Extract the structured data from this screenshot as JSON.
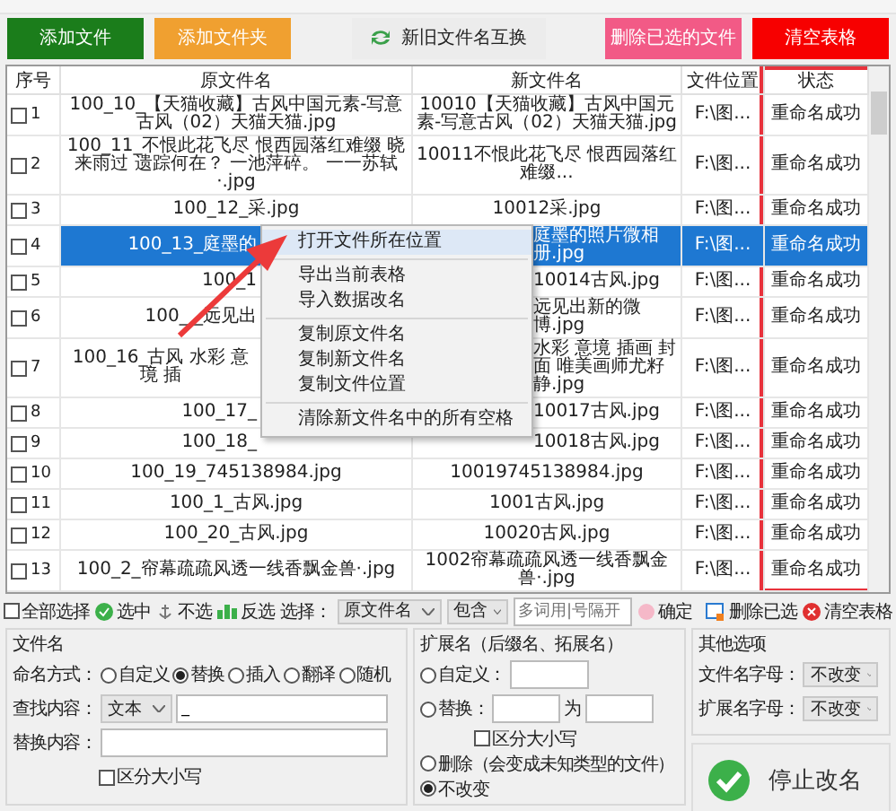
{
  "top_buttons": [
    {
      "label": "添加文件",
      "color": "#1b7d1b"
    },
    {
      "label": "添加文件夹",
      "color": "#f0a030"
    },
    {
      "label": "删除已选的文件",
      "color": "#f25a86"
    },
    {
      "label": "清空表格",
      "color": "#f70000"
    }
  ],
  "swap_button": {
    "label": "新旧文件名互换"
  },
  "table": {
    "columns": [
      "序号",
      "原文件名",
      "新文件名",
      "文件位置",
      "状态"
    ],
    "rows": [
      {
        "index": "1",
        "checked": false,
        "selected": false,
        "covered": false,
        "original": "100_10_【天猫收藏】古风中国元素-写意古风（02）天猫天猫.jpg",
        "new": "10010【天猫收藏】古风中国元素-写意古风（02）天猫天猫.jpg",
        "location": "F:\\图...",
        "status": "重命名成功"
      },
      {
        "index": "2",
        "checked": false,
        "selected": false,
        "covered": false,
        "original": "100_11_不恨此花飞尽 恨西园落红难缀 晓来雨过 遗踪何在？ 一池萍碎。 一一苏轼·.jpg",
        "new": "10011不恨此花飞尽 恨西园落红难缀...",
        "location": "F:\\图...",
        "status": "重命名成功"
      },
      {
        "index": "3",
        "checked": false,
        "selected": false,
        "covered": false,
        "original": "100_12_采.jpg",
        "new": "10012采.jpg",
        "location": "F:\\图...",
        "status": "重命名成功"
      },
      {
        "index": "4",
        "checked": false,
        "selected": true,
        "covered": true,
        "original": "100_13_庭墨的",
        "new": "庭墨的照片微相册.jpg",
        "location": "F:\\图...",
        "status": "重命名成功"
      },
      {
        "index": "5",
        "checked": false,
        "selected": false,
        "covered": true,
        "original": "100_1",
        "new": "10014古风.jpg",
        "location": "F:\\图...",
        "status": "重命名成功"
      },
      {
        "index": "6",
        "checked": false,
        "selected": false,
        "covered": true,
        "original": "100_  _远见出",
        "new": "远见出新的微博.jpg",
        "location": "F:\\图...",
        "status": "重命名成功"
      },
      {
        "index": "7",
        "checked": false,
        "selected": false,
        "covered": true,
        "original": "100_16_古风 水彩 意境 插",
        "new": "水彩 意境 插画 封面 唯美画师尤籽静.jpg",
        "location": "F:\\图...",
        "status": "重命名成功"
      },
      {
        "index": "8",
        "checked": false,
        "selected": false,
        "covered": true,
        "original": "100_17_",
        "new": "10017古风.jpg",
        "location": "F:\\图...",
        "status": "重命名成功"
      },
      {
        "index": "9",
        "checked": false,
        "selected": false,
        "covered": true,
        "original": "100_18_",
        "new": "10018古风.jpg",
        "location": "F:\\图...",
        "status": "重命名成功"
      },
      {
        "index": "10",
        "checked": false,
        "selected": false,
        "covered": false,
        "original": "100_19_745138984.jpg",
        "new": "10019745138984.jpg",
        "location": "F:\\图...",
        "status": "重命名成功"
      },
      {
        "index": "11",
        "checked": false,
        "selected": false,
        "covered": false,
        "original": "100_1_古风.jpg",
        "new": "1001古风.jpg",
        "location": "F:\\图...",
        "status": "重命名成功"
      },
      {
        "index": "12",
        "checked": false,
        "selected": false,
        "covered": false,
        "original": "100_20_古风.jpg",
        "new": "10020古风.jpg",
        "location": "F:\\图...",
        "status": "重命名成功"
      },
      {
        "index": "13",
        "checked": false,
        "selected": false,
        "covered": false,
        "original": "100_2_帘幕疏疏风透一线香飘金兽·.jpg",
        "new": "1002帘幕疏疏风透一线香飘金兽·.jpg",
        "location": "F:\\图...",
        "status": "重命名成功"
      }
    ]
  },
  "context_menu": {
    "groups": [
      [
        {
          "label": "打开文件所在位置",
          "selected": true
        }
      ],
      [
        {
          "label": "导出当前表格",
          "selected": false
        },
        {
          "label": "导入数据改名",
          "selected": false
        }
      ],
      [
        {
          "label": "复制原文件名",
          "selected": false
        },
        {
          "label": "复制新文件名",
          "selected": false
        },
        {
          "label": "复制文件位置",
          "selected": false
        }
      ],
      [
        {
          "label": "清除新文件名中的所有空格",
          "selected": false
        }
      ]
    ]
  },
  "toolbar": {
    "select_all": {
      "label": "全部选择",
      "checked": false
    },
    "select": "选中",
    "deselect": "不选",
    "invert": "反选",
    "filter_label": "选择：",
    "field_select": "原文件名",
    "match_select": "包含",
    "keyword_placeholder": "多词用|号隔开",
    "confirm": "确定",
    "delete_selected": "删除已选",
    "clear_table": "清空表格"
  },
  "filename_panel": {
    "title": "文件名",
    "mode_label": "命名方式：",
    "modes": [
      {
        "label": "自定义",
        "selected": false
      },
      {
        "label": "替换",
        "selected": true
      },
      {
        "label": "插入",
        "selected": false
      },
      {
        "label": "翻译",
        "selected": false
      },
      {
        "label": "随机",
        "selected": false
      }
    ],
    "find_label": "查找内容：",
    "find_type": "文本",
    "find_value": "_",
    "replace_label": "替换内容：",
    "case_sensitive": {
      "label": "区分大小写",
      "checked": false
    }
  },
  "extension_panel": {
    "title": "扩展名（后缀名、拓展名）",
    "custom": {
      "label": "自定义：",
      "selected": false
    },
    "replace": {
      "label": "替换：",
      "selected": false
    },
    "to_label": "为",
    "case_sensitive": {
      "label": "区分大小写",
      "checked": false
    },
    "delete": {
      "label": "删除（会变成未知类型的文件）",
      "selected": false
    },
    "keep": {
      "label": "不改变",
      "selected": true
    }
  },
  "other_panel": {
    "title": "其他选项",
    "filename_case_label": "文件名字母：",
    "filename_case": "不改变",
    "ext_case_label": "扩展名字母：",
    "ext_case": "不改变"
  },
  "stop_button": {
    "label": "停止改名"
  }
}
